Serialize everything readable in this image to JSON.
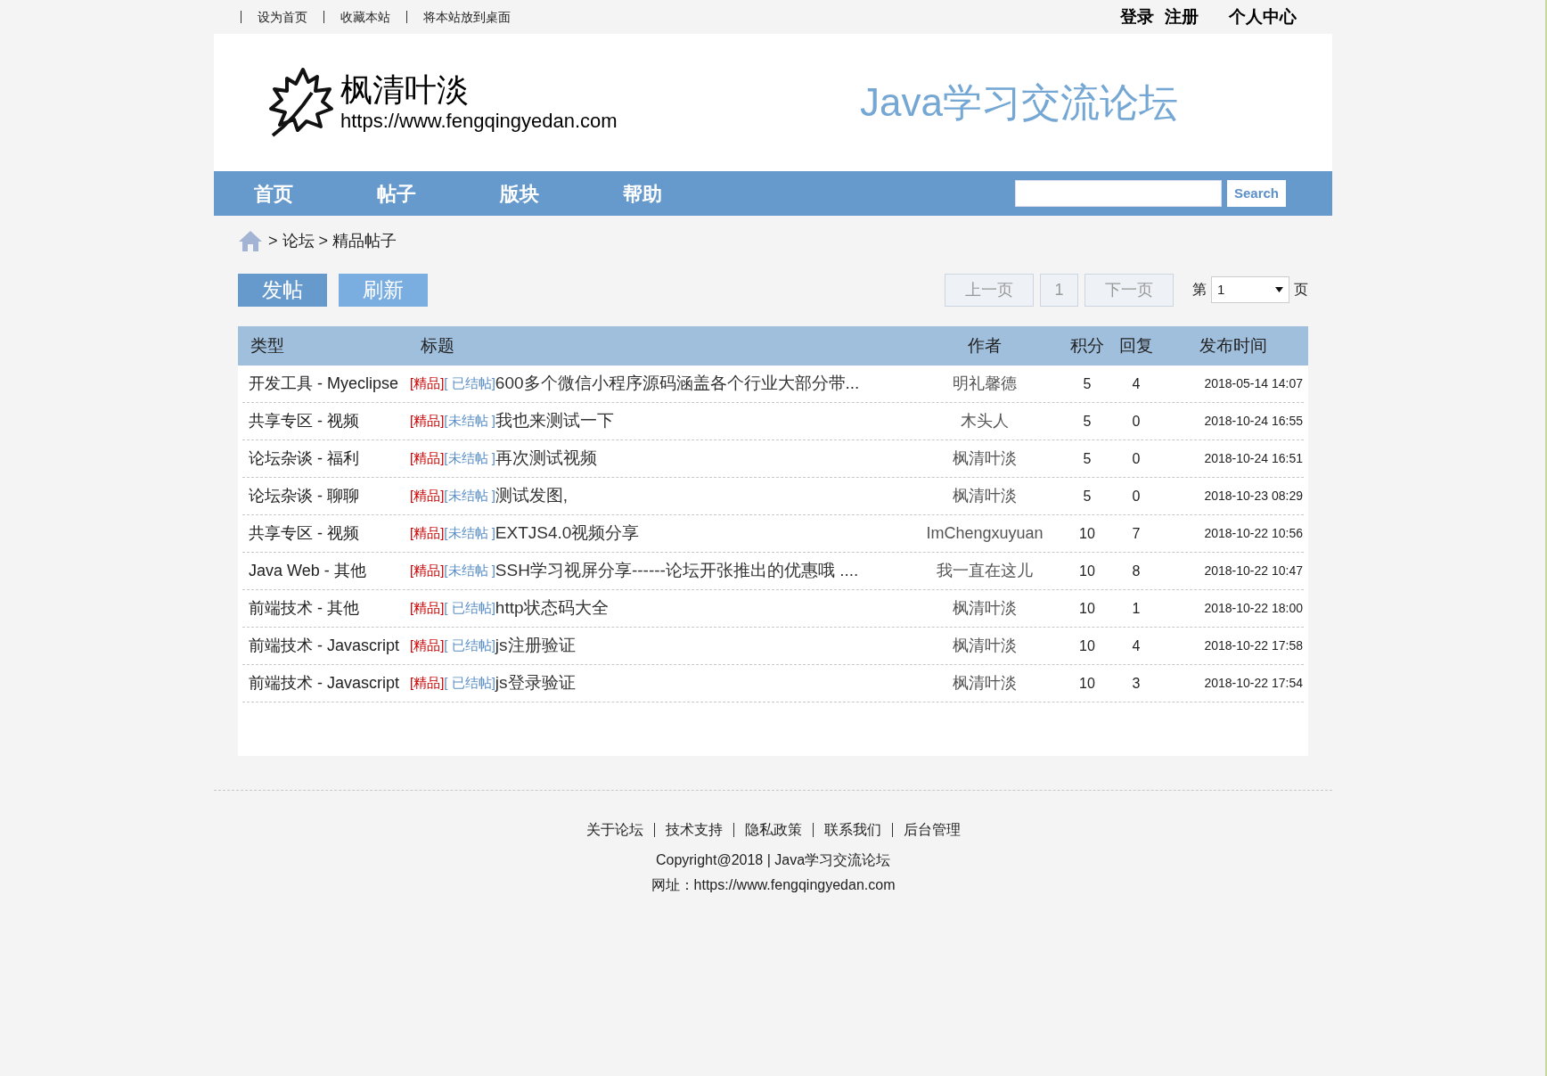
{
  "top_bar": {
    "links": [
      {
        "label": "设为首页"
      },
      {
        "label": "收藏本站"
      },
      {
        "label": "将本站放到桌面"
      }
    ],
    "user_links": [
      {
        "label": "登录"
      },
      {
        "label": "注册"
      },
      {
        "label": "个人中心"
      }
    ]
  },
  "header": {
    "logo_name": "枫清叶淡",
    "logo_url": "https://www.fengqingyedan.com",
    "slogan": "Java学习交流论坛"
  },
  "nav": {
    "items": [
      {
        "label": "首页"
      },
      {
        "label": "帖子"
      },
      {
        "label": "版块"
      },
      {
        "label": "帮助"
      }
    ],
    "search_button": "Search"
  },
  "breadcrumb": "> 论坛 > 精品帖子",
  "actions": [
    {
      "label": "发帖",
      "kind": "primary"
    },
    {
      "label": "刷新",
      "kind": "secondary"
    }
  ],
  "pagination": {
    "prev": "上一页",
    "current": "1",
    "next": "下一页",
    "page_prefix": "第",
    "page_value": "1",
    "page_suffix": "页"
  },
  "table": {
    "columns": [
      "类型",
      "标题",
      "作者",
      "积分",
      "回复",
      "发布时间"
    ],
    "rows": [
      {
        "type": "开发工具 - Myeclipse",
        "tags": [
          {
            "text": "[精品]",
            "kind": "featured"
          },
          {
            "text": "[ 已结帖]",
            "kind": "status"
          }
        ],
        "title": "600多个微信小程序源码涵盖各个行业大部分带...",
        "author": "明礼馨德",
        "score": "5",
        "replies": "4",
        "time": "2018-05-14 14:07"
      },
      {
        "type": "共享专区 - 视频",
        "tags": [
          {
            "text": "[精品]",
            "kind": "featured"
          },
          {
            "text": "[未结帖 ]",
            "kind": "status"
          }
        ],
        "title": "我也来测试一下",
        "author": "木头人",
        "score": "5",
        "replies": "0",
        "time": "2018-10-24 16:55"
      },
      {
        "type": "论坛杂谈 - 福利",
        "tags": [
          {
            "text": "[精品]",
            "kind": "featured"
          },
          {
            "text": "[未结帖 ]",
            "kind": "status"
          }
        ],
        "title": "再次测试视频",
        "author": "枫清叶淡",
        "score": "5",
        "replies": "0",
        "time": "2018-10-24 16:51"
      },
      {
        "type": "论坛杂谈 - 聊聊",
        "tags": [
          {
            "text": "[精品]",
            "kind": "featured"
          },
          {
            "text": "[未结帖 ]",
            "kind": "status"
          }
        ],
        "title": "测试发图,",
        "author": "枫清叶淡",
        "score": "5",
        "replies": "0",
        "time": "2018-10-23 08:29"
      },
      {
        "type": "共享专区 - 视频",
        "tags": [
          {
            "text": "[精品]",
            "kind": "featured"
          },
          {
            "text": "[未结帖 ]",
            "kind": "status"
          }
        ],
        "title": "EXTJS4.0视频分享",
        "author": "ImChengxuyuan",
        "score": "10",
        "replies": "7",
        "time": "2018-10-22 10:56"
      },
      {
        "type": "Java Web - 其他",
        "tags": [
          {
            "text": "[精品]",
            "kind": "featured"
          },
          {
            "text": "[未结帖 ]",
            "kind": "status"
          }
        ],
        "title": "SSH学习视屏分享------论坛开张推出的优惠哦 ....",
        "author": "我一直在这儿",
        "score": "10",
        "replies": "8",
        "time": "2018-10-22 10:47"
      },
      {
        "type": "前端技术 - 其他",
        "tags": [
          {
            "text": "[精品]",
            "kind": "featured"
          },
          {
            "text": "[ 已结帖]",
            "kind": "status"
          }
        ],
        "title": "http状态码大全",
        "author": "枫清叶淡",
        "score": "10",
        "replies": "1",
        "time": "2018-10-22 18:00"
      },
      {
        "type": "前端技术 - Javascript",
        "tags": [
          {
            "text": "[精品]",
            "kind": "featured"
          },
          {
            "text": "[ 已结帖]",
            "kind": "status"
          }
        ],
        "title": "js注册验证",
        "author": "枫清叶淡",
        "score": "10",
        "replies": "4",
        "time": "2018-10-22 17:58"
      },
      {
        "type": "前端技术 - Javascript",
        "tags": [
          {
            "text": "[精品]",
            "kind": "featured"
          },
          {
            "text": "[ 已结帖]",
            "kind": "status"
          }
        ],
        "title": "js登录验证",
        "author": "枫清叶淡",
        "score": "10",
        "replies": "3",
        "time": "2018-10-22 17:54"
      }
    ]
  },
  "footer": {
    "links": [
      {
        "label": "关于论坛"
      },
      {
        "label": "技术支持"
      },
      {
        "label": "隐私政策"
      },
      {
        "label": "联系我们"
      },
      {
        "label": "后台管理"
      }
    ],
    "copyright": "Copyright@2018 | Java学习交流论坛",
    "address": "网址：https://www.fengqingyedan.com"
  }
}
